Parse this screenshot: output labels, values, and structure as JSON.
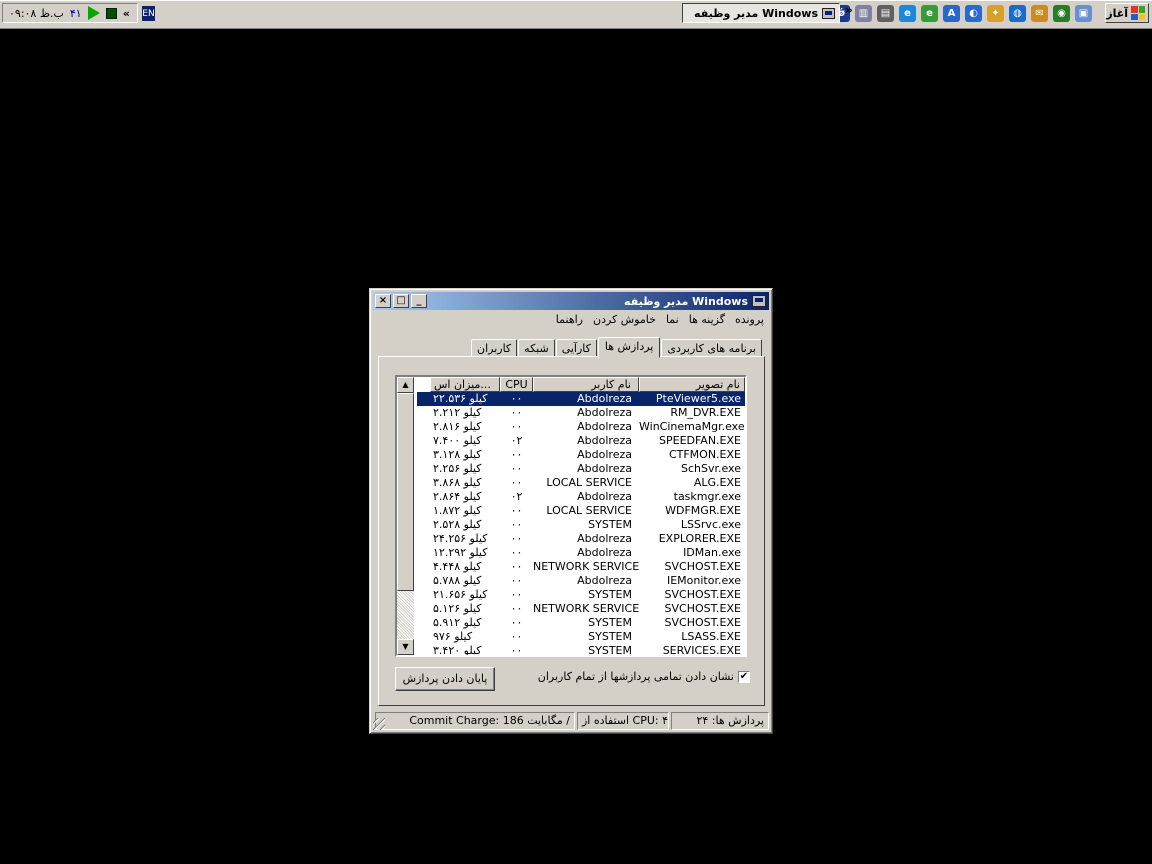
{
  "taskbar": {
    "start_label": "آغاز",
    "task_button_label": "مدیر وظیفه Windows",
    "overflow_chevron": "»",
    "language": "EN",
    "tray": {
      "clock": "۰۹:۰۸ ب.ظ",
      "number": "۴۱",
      "chevron": "«"
    },
    "quicklaunch_icons": [
      "app-icon",
      "network-icon",
      "email-icon",
      "globe-icon",
      "gift-icon",
      "browser-icon",
      "folder-icon",
      "font-icon",
      "settings-icon",
      "ie-icon",
      "document-icon",
      "firefox-icon"
    ]
  },
  "window": {
    "title": "مدیر وظیفه Windows",
    "controls": {
      "close": "×",
      "maximize": "□",
      "minimize": "_"
    },
    "menu": [
      "پرونده",
      "گزینه ها",
      "نما",
      "خاموش کردن",
      "راهنما"
    ],
    "tabs": [
      "برنامه های کاربردی",
      "پردازش ها",
      "کارآیی",
      "شبکه",
      "کاربران"
    ],
    "active_tab": 1,
    "columns": {
      "name": "نام تصویر",
      "user": "نام کاربر",
      "cpu": "CPU",
      "mem": "میزان اس..."
    },
    "processes": [
      {
        "name": "PteViewer5.exe",
        "user": "Abdolreza",
        "cpu": "۰۰",
        "mem": "۲۲.۵۳۶ کیلو"
      },
      {
        "name": "RM_DVR.EXE",
        "user": "Abdolreza",
        "cpu": "۰۰",
        "mem": "۲.۲۱۲ کیلو"
      },
      {
        "name": "WinCinemaMgr.exe",
        "user": "Abdolreza",
        "cpu": "۰۰",
        "mem": "۲.۸۱۶ کیلو"
      },
      {
        "name": "SPEEDFAN.EXE",
        "user": "Abdolreza",
        "cpu": "۰۲",
        "mem": "۷.۴۰۰ کیلو"
      },
      {
        "name": "CTFMON.EXE",
        "user": "Abdolreza",
        "cpu": "۰۰",
        "mem": "۳.۱۲۸ کیلو"
      },
      {
        "name": "SchSvr.exe",
        "user": "Abdolreza",
        "cpu": "۰۰",
        "mem": "۲.۲۵۶ کیلو"
      },
      {
        "name": "ALG.EXE",
        "user": "LOCAL SERVICE",
        "cpu": "۰۰",
        "mem": "۳.۸۶۸ کیلو"
      },
      {
        "name": "taskmgr.exe",
        "user": "Abdolreza",
        "cpu": "۰۲",
        "mem": "۲.۸۶۴ کیلو"
      },
      {
        "name": "WDFMGR.EXE",
        "user": "LOCAL SERVICE",
        "cpu": "۰۰",
        "mem": "۱.۸۷۲ کیلو"
      },
      {
        "name": "LSSrvc.exe",
        "user": "SYSTEM",
        "cpu": "۰۰",
        "mem": "۲.۵۲۸ کیلو"
      },
      {
        "name": "EXPLORER.EXE",
        "user": "Abdolreza",
        "cpu": "۰۰",
        "mem": "۲۴.۲۵۶ کیلو"
      },
      {
        "name": "IDMan.exe",
        "user": "Abdolreza",
        "cpu": "۰۰",
        "mem": "۱۲.۲۹۲ کیلو"
      },
      {
        "name": "SVCHOST.EXE",
        "user": "NETWORK SERVICE",
        "cpu": "۰۰",
        "mem": "۴.۴۴۸ کیلو"
      },
      {
        "name": "IEMonitor.exe",
        "user": "Abdolreza",
        "cpu": "۰۰",
        "mem": "۵.۷۸۸ کیلو"
      },
      {
        "name": "SVCHOST.EXE",
        "user": "SYSTEM",
        "cpu": "۰۰",
        "mem": "۲۱.۶۵۶ کیلو"
      },
      {
        "name": "SVCHOST.EXE",
        "user": "NETWORK SERVICE",
        "cpu": "۰۰",
        "mem": "۵.۱۲۶ کیلو"
      },
      {
        "name": "SVCHOST.EXE",
        "user": "SYSTEM",
        "cpu": "۰۰",
        "mem": "۵.۹۱۲ کیلو"
      },
      {
        "name": "LSASS.EXE",
        "user": "SYSTEM",
        "cpu": "۰۰",
        "mem": "۹۷۶ کیلو"
      },
      {
        "name": "SERVICES.EXE",
        "user": "SYSTEM",
        "cpu": "۰۰",
        "mem": "۳.۴۲۰ کیلو"
      }
    ],
    "show_all_checkbox": {
      "label": "نشان دادن تمامی پردازشها از تمام کاربران",
      "checked": true
    },
    "end_process_label": "پایان دادن پردازش",
    "status": {
      "processes": "پردازش ها: ۲۴",
      "cpu": "استفاده از CPU: ۴%",
      "commit": "Commit Charge: 186 مگابایت /"
    }
  }
}
